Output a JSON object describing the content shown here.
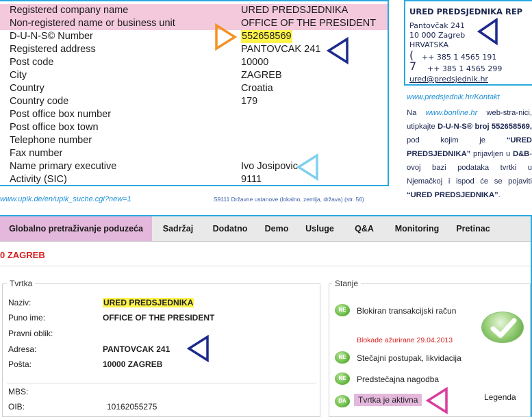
{
  "upik": {
    "rows": [
      {
        "label": "Registered company name",
        "value": "URED PREDSJEDNIKA"
      },
      {
        "label": "Non-registered name or business unit",
        "value": "OFFICE OF THE PRESIDENT"
      },
      {
        "label": "D-U-N-S© Number",
        "value": "552658569"
      },
      {
        "label": "Registered address",
        "value": "PANTOVCAK 241"
      },
      {
        "label": "Post code",
        "value": "10000"
      },
      {
        "label": "City",
        "value": "ZAGREB"
      },
      {
        "label": "Country",
        "value": "Croatia"
      },
      {
        "label": "Country code",
        "value": "179"
      },
      {
        "label": "Post office box number",
        "value": ""
      },
      {
        "label": "Post office box town",
        "value": ""
      },
      {
        "label": "Telephone number",
        "value": ""
      },
      {
        "label": "Fax number",
        "value": ""
      },
      {
        "label": "Name primary executive",
        "value": "Ivo Josipovic"
      },
      {
        "label": "Activity (SIC)",
        "value": "9111"
      }
    ],
    "url": "www.upik.de/en/upik_suche.cgi?new=1",
    "caption": "S9111 Državne ustanove (lokalno, zemlja, država) (str. 56)"
  },
  "card": {
    "title": "URED PREDSJEDNIKA REP",
    "street": "Pantovčak 241",
    "city": "10 000 Zagreb",
    "country": "HRVATSKA",
    "phone_glyph": "(",
    "fax_glyph": "7",
    "phone": "++ 385 1 4565 191",
    "fax": "++ 385 1 4565 299",
    "email": "ured@predsjednik.hr"
  },
  "kontakt_url": "www.predsjednik.hr/Kontakt",
  "note": {
    "p1": "Na",
    "link": "www.bonline.hr",
    "p2": "web-stra-nici, utipkajte",
    "duns_label": "D-U-N-S® broj 552658569,",
    "p3": "pod kojim je",
    "company_q": "“URED PREDSJEDNIKA”",
    "p4": "prijavljen u",
    "db": "D&B",
    "p5": "-ovoj bazi podataka tvrtki u Njemačkoj i ispod će se pojaviti",
    "company_end": "“URED PREDSJEDNIKA”",
    "end": "."
  },
  "bonline": {
    "nav": [
      {
        "label": "Globalno pretraživanje poduzeća",
        "active": true
      },
      {
        "label": "Sadržaj",
        "active": false
      },
      {
        "label": "Dodatno",
        "active": false
      },
      {
        "label": "Demo",
        "active": false
      },
      {
        "label": "Usluge",
        "active": false
      },
      {
        "label": "Q&A",
        "active": false
      },
      {
        "label": "Monitoring",
        "active": false
      },
      {
        "label": "Pretinac",
        "active": false
      }
    ],
    "city_title": "0 ZAGREB",
    "tvrtka": {
      "legend": "Tvrtka",
      "naziv_label": "Naziv:",
      "naziv": "URED PREDSJEDNIKA",
      "puno_ime_label": "Puno ime:",
      "puno_ime": "OFFICE OF THE PRESIDENT",
      "pravni_oblik_label": "Pravni oblik:",
      "adresa_label": "Adresa:",
      "adresa": "PANTOVCAK 241",
      "posta_label": "Pošta:",
      "posta": "10000 ZAGREB",
      "mbs_label": "MBS:",
      "oib_label": "OIB:",
      "oib": "10162055275"
    },
    "stanje": {
      "legend": "Stanje",
      "items": [
        {
          "badge": "NE",
          "label": "Blokiran transakcijski račun"
        },
        {
          "badge": "NE",
          "label": "Stečajni postupak, likvidacija"
        },
        {
          "badge": "NE",
          "label": "Predstečajna nagodba"
        },
        {
          "badge": "DA",
          "label": "Tvrtka je aktivna"
        }
      ],
      "blokade": "Blokade ažurirane 29.04.2013",
      "legenda": "Legenda"
    }
  },
  "colors": {
    "frame_blue": "#29a9e1",
    "pink_highlight": "#f4c9dc",
    "yellow_highlight": "#fff34a",
    "arrow_blue": "#1c2a8c",
    "arrow_orange": "#f39222",
    "arrow_cyan": "#7fd0ef",
    "arrow_magenta": "#d83e9c",
    "alert_red": "#d81e1e"
  },
  "icons": [
    "pointer-triangle-icon",
    "phone-icon",
    "fax-icon",
    "status-badge-icon",
    "checkmark-icon"
  ]
}
